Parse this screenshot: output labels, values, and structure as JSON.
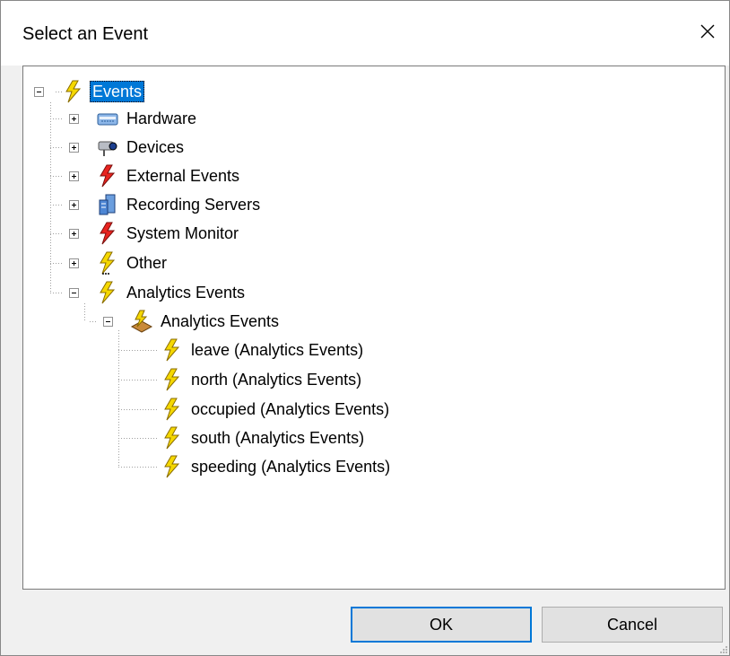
{
  "dialog": {
    "title": "Select an Event",
    "ok_label": "OK",
    "cancel_label": "Cancel"
  },
  "tree": {
    "root": {
      "label": "Events",
      "icon": "lightning-yellow-icon",
      "expanded": true,
      "selected": true
    },
    "items": [
      {
        "label": "Hardware",
        "icon": "hardware-icon",
        "expanded": false
      },
      {
        "label": "Devices",
        "icon": "camera-icon",
        "expanded": false
      },
      {
        "label": "External Events",
        "icon": "lightning-red-icon",
        "expanded": false
      },
      {
        "label": "Recording Servers",
        "icon": "server-icon",
        "expanded": false
      },
      {
        "label": "System Monitor",
        "icon": "lightning-red-icon",
        "expanded": false
      },
      {
        "label": "Other",
        "icon": "lightning-yellow-icon",
        "expanded": false
      },
      {
        "label": "Analytics Events",
        "icon": "lightning-yellow-icon",
        "expanded": true
      }
    ],
    "analytics_group": {
      "label": "Analytics Events",
      "icon": "analytics-group-icon",
      "expanded": true
    },
    "analytics_events": [
      {
        "label": "leave (Analytics Events)",
        "icon": "lightning-yellow-icon"
      },
      {
        "label": "north (Analytics Events)",
        "icon": "lightning-yellow-icon"
      },
      {
        "label": "occupied (Analytics Events)",
        "icon": "lightning-yellow-icon"
      },
      {
        "label": "south (Analytics Events)",
        "icon": "lightning-yellow-icon"
      },
      {
        "label": "speeding (Analytics Events)",
        "icon": "lightning-yellow-icon"
      }
    ]
  },
  "colors": {
    "selection": "#0078d7",
    "bolt_yellow": "#f5d800",
    "bolt_red": "#e8231f"
  }
}
